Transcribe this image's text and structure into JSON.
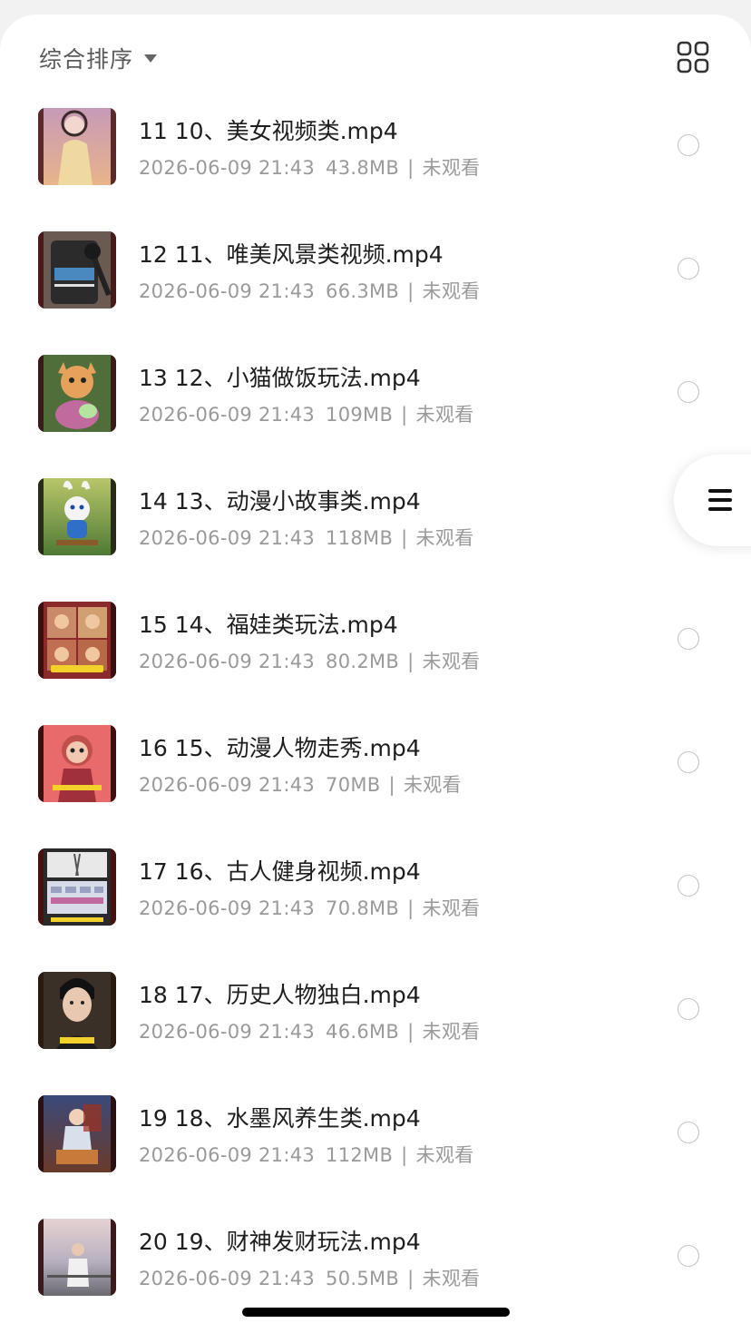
{
  "sort": {
    "label": "综合排序"
  },
  "icons": {
    "view_toggle": "grid-view-icon",
    "sort_caret": "caret-down-icon",
    "floating_menu": "menu-icon",
    "row_select": "radio-unchecked-icon"
  },
  "files": [
    {
      "title": "11 10、美女视频类.mp4",
      "date": "2026-06-09 21:43",
      "size": "43.8MB",
      "status": "未观看",
      "thumb": "thumb-woman"
    },
    {
      "title": "12 11、唯美风景类视频.mp4",
      "date": "2026-06-09 21:43",
      "size": "66.3MB",
      "status": "未观看",
      "thumb": "thumb-phone-editor"
    },
    {
      "title": "13 12、小猫做饭玩法.mp4",
      "date": "2026-06-09 21:43",
      "size": "109MB",
      "status": "未观看",
      "thumb": "thumb-cat-cooking"
    },
    {
      "title": "14 13、动漫小故事类.mp4",
      "date": "2026-06-09 21:43",
      "size": "118MB",
      "status": "未观看",
      "thumb": "thumb-bunny-forest"
    },
    {
      "title": "15 14、福娃类玩法.mp4",
      "date": "2026-06-09 21:43",
      "size": "80.2MB",
      "status": "未观看",
      "thumb": "thumb-fuwa"
    },
    {
      "title": "16 15、动漫人物走秀.mp4",
      "date": "2026-06-09 21:43",
      "size": "70MB",
      "status": "未观看",
      "thumb": "thumb-anime-character"
    },
    {
      "title": "17 16、古人健身视频.mp4",
      "date": "2026-06-09 21:43",
      "size": "70.8MB",
      "status": "未观看",
      "thumb": "thumb-phone-keyboard"
    },
    {
      "title": "18 17、历史人物独白.mp4",
      "date": "2026-06-09 21:43",
      "size": "46.6MB",
      "status": "未观看",
      "thumb": "thumb-portrait-man"
    },
    {
      "title": "19 18、水墨风养生类.mp4",
      "date": "2026-06-09 21:43",
      "size": "112MB",
      "status": "未观看",
      "thumb": "thumb-ink-style"
    },
    {
      "title": "20 19、财神发财玩法.mp4",
      "date": "2026-06-09 21:43",
      "size": "50.5MB",
      "status": "未观看",
      "thumb": "thumb-seaside-man"
    }
  ],
  "colors": {
    "title_text": "#1e1e1e",
    "meta_text": "#9a9a9a",
    "radio_border": "#c4c4c4",
    "background": "#ffffff"
  }
}
